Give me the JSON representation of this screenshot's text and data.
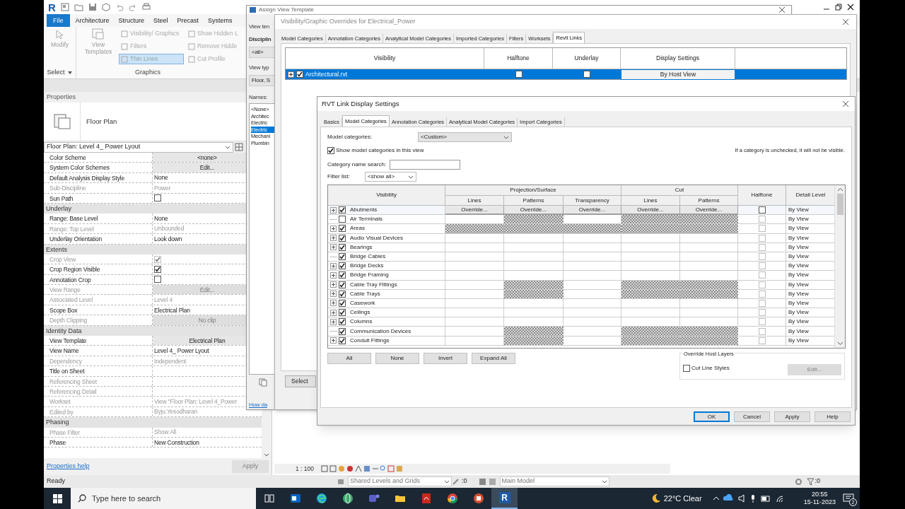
{
  "revit": {
    "quick_access_logo": "R",
    "ribbon_tabs": [
      {
        "label": "File",
        "selected": true
      },
      {
        "label": "Architecture",
        "selected": false
      },
      {
        "label": "Structure",
        "selected": false
      },
      {
        "label": "Steel",
        "selected": false
      },
      {
        "label": "Precast",
        "selected": false
      },
      {
        "label": "Systems",
        "selected": false
      }
    ],
    "ribbon": {
      "modify": "Modify",
      "select": "Select",
      "view_templates": "View Templates",
      "graphics_tools": [
        {
          "label": "Visibility/ Graphics",
          "selected": false
        },
        {
          "label": "Filters",
          "selected": false
        },
        {
          "label": "Thin Lines",
          "selected": true
        }
      ],
      "hidden_tools": [
        "Show Hidden L",
        "Remove Hidde",
        "Cut Profile"
      ],
      "panel_label": "Graphics"
    },
    "properties": {
      "title": "Properties",
      "type_name": "Floor Plan",
      "view_selector": "Floor Plan: Level 4_ Power Lyout",
      "groups": [
        {
          "rows": [
            {
              "name": "Color Scheme",
              "kind": "button",
              "value": "<none>",
              "disabled": false
            },
            {
              "name": "System Color Schemes",
              "kind": "button",
              "value": "Edit...",
              "disabled": false
            },
            {
              "name": "Default Analysis Display Style",
              "kind": "text",
              "value": "None",
              "disabled": false
            },
            {
              "name": "Sub-Discipline",
              "kind": "text",
              "value": "Power",
              "disabled": true
            },
            {
              "name": "Sun Path",
              "kind": "checkbox",
              "checked": false,
              "disabled": false
            }
          ]
        },
        {
          "title": "Underlay",
          "rows": [
            {
              "name": "Range: Base Level",
              "kind": "text",
              "value": "None",
              "disabled": false
            },
            {
              "name": "Range: Top Level",
              "kind": "text",
              "value": "Unbounded",
              "disabled": true
            },
            {
              "name": "Underlay Orientation",
              "kind": "text",
              "value": "Look down",
              "disabled": false
            }
          ]
        },
        {
          "title": "Extents",
          "rows": [
            {
              "name": "Crop View",
              "kind": "checkbox",
              "checked": true,
              "disabled": true
            },
            {
              "name": "Crop Region Visible",
              "kind": "checkbox",
              "checked": true,
              "disabled": false
            },
            {
              "name": "Annotation Crop",
              "kind": "checkbox",
              "checked": false,
              "disabled": false
            },
            {
              "name": "View Range",
              "kind": "button",
              "value": "Edit...",
              "disabled": true
            },
            {
              "name": "Associated Level",
              "kind": "text",
              "value": "Level 4",
              "disabled": true
            },
            {
              "name": "Scope Box",
              "kind": "text",
              "value": "Electrical Plan",
              "disabled": false
            },
            {
              "name": "Depth Clipping",
              "kind": "button",
              "value": "No clip",
              "disabled": true
            }
          ]
        },
        {
          "title": "Identity Data",
          "rows": [
            {
              "name": "View Template",
              "kind": "button",
              "value": "Electrical Plan",
              "disabled": false
            },
            {
              "name": "View Name",
              "kind": "text",
              "value": "Level 4_ Power Lyout",
              "disabled": false
            },
            {
              "name": "Dependency",
              "kind": "text",
              "value": "Independent",
              "disabled": true
            },
            {
              "name": "Title on Sheet",
              "kind": "text",
              "disabled": false
            },
            {
              "name": "Referencing Sheet",
              "kind": "text",
              "disabled": true
            },
            {
              "name": "Referencing Detail",
              "kind": "text",
              "disabled": true
            },
            {
              "name": "Workset",
              "kind": "text",
              "value": "View \"Floor Plan: Level 4_Power",
              "disabled": true
            },
            {
              "name": "Edited by",
              "kind": "text",
              "value": "Byju.Yesodharan",
              "disabled": true
            }
          ]
        },
        {
          "title": "Phasing",
          "rows": [
            {
              "name": "Phase Filter",
              "kind": "text",
              "value": "Show All",
              "disabled": true
            },
            {
              "name": "Phase",
              "kind": "text",
              "value": "New Construction",
              "disabled": false
            }
          ]
        }
      ],
      "help_link": "Properties help",
      "apply": {
        "label": "Apply",
        "disabled": true
      }
    },
    "view_bar": {
      "scale": "1 : 100"
    },
    "status_bar": {
      "text": "Ready",
      "workset": "Shared Levels and Grids",
      "editable_count": ":0",
      "design_option": "Main Model",
      "filter_count": ":0"
    }
  },
  "assign_dialog": {
    "title": "Assign View Template",
    "view_templates_label": "View ten",
    "discipline_label": "Disciplin",
    "discipline_value": "<all>",
    "view_type_label": "View typ",
    "view_type_value": "Floor, S",
    "names_label": "Names:",
    "names": [
      {
        "label": "<None>",
        "selected": false
      },
      {
        "label": "Architec",
        "selected": false
      },
      {
        "label": "Electric",
        "selected": false
      },
      {
        "label": "Electric",
        "selected": true
      },
      {
        "label": "Mechani",
        "selected": false
      },
      {
        "label": "Plumbin",
        "selected": false
      }
    ],
    "help_link": "How da"
  },
  "vg_dialog": {
    "title": "Visibility/Graphic Overrides for Electrical_Power",
    "tabs": [
      {
        "label": "Model Categories",
        "selected": false
      },
      {
        "label": "Annotation Categories",
        "selected": false
      },
      {
        "label": "Analytical Model Categories",
        "selected": false
      },
      {
        "label": "Imported Categories",
        "selected": false
      },
      {
        "label": "Filters",
        "selected": false
      },
      {
        "label": "Worksets",
        "selected": false
      },
      {
        "label": "Revit Links",
        "selected": true
      }
    ],
    "columns": [
      "Visibility",
      "Halftone",
      "Underlay",
      "Display Settings"
    ],
    "links": [
      {
        "name": "Architectural.rvt",
        "visible": true,
        "halftone": false,
        "underlay": false,
        "display": "By Host View",
        "selected": true
      }
    ],
    "bottom_button": "Select"
  },
  "rvt_dialog": {
    "title": "RVT Link Display Settings",
    "tabs": [
      {
        "label": "Basics",
        "selected": false
      },
      {
        "label": "Model Categories",
        "selected": true
      },
      {
        "label": "Annotation Categories",
        "selected": false
      },
      {
        "label": "Analytical Model Categories",
        "selected": false
      },
      {
        "label": "Import Categories",
        "selected": false
      }
    ],
    "model_categories_label": "Model categories:",
    "model_categories_value": "<Custom>",
    "show_categories": {
      "label": "Show model categories in this view",
      "checked": true
    },
    "note": "If a category is unchecked, it will not be visible.",
    "search_label": "Category name search:",
    "filter_label": "Filter list:",
    "filter_value": "<show all>",
    "columns": {
      "visibility": "Visibility",
      "projection": {
        "title": "Projection/Surface",
        "subcolumns": [
          "Lines",
          "Patterns",
          "Transparency"
        ]
      },
      "cut": {
        "title": "Cut",
        "subcolumns": [
          "Lines",
          "Patterns"
        ]
      },
      "halftone": "Halftone",
      "detail_level": "Detail Level"
    },
    "rows": [
      {
        "name": "Abutments",
        "visible": true,
        "expandable": true,
        "selected": true,
        "cells": [
          {
            "kind": "button",
            "label": "Override..."
          },
          {
            "kind": "button",
            "label": "Override..."
          },
          {
            "kind": "button",
            "label": "Override..."
          },
          {
            "kind": "button",
            "label": "Override..."
          },
          {
            "kind": "button",
            "label": "Override..."
          }
        ],
        "halftone": false,
        "detail_level": "By View"
      },
      {
        "name": "Air Terminals",
        "visible": false,
        "expandable": false,
        "selected": false,
        "cells": [
          {
            "kind": "blank"
          },
          {
            "kind": "hatched"
          },
          {
            "kind": "blank"
          },
          {
            "kind": "hatched"
          },
          {
            "kind": "hatched"
          }
        ],
        "halftone": false,
        "detail_level": "By View"
      },
      {
        "name": "Areas",
        "visible": true,
        "expandable": true,
        "selected": false,
        "cells": [
          {
            "kind": "hatched"
          },
          {
            "kind": "hatched"
          },
          {
            "kind": "hatched"
          },
          {
            "kind": "hatched"
          },
          {
            "kind": "hatched"
          }
        ],
        "halftone": false,
        "detail_level": "By View"
      },
      {
        "name": "Audio Visual Devices",
        "visible": true,
        "expandable": true,
        "selected": false,
        "cells": [
          {
            "kind": "blank"
          },
          {
            "kind": "blank"
          },
          {
            "kind": "blank"
          },
          {
            "kind": "blank"
          },
          {
            "kind": "blank"
          }
        ],
        "halftone": false,
        "detail_level": "By View"
      },
      {
        "name": "Bearings",
        "visible": true,
        "expandable": true,
        "selected": false,
        "cells": [
          {
            "kind": "blank"
          },
          {
            "kind": "blank"
          },
          {
            "kind": "blank"
          },
          {
            "kind": "blank"
          },
          {
            "kind": "blank"
          }
        ],
        "halftone": false,
        "detail_level": "By View"
      },
      {
        "name": "Bridge Cables",
        "visible": true,
        "expandable": false,
        "selected": false,
        "cells": [
          {
            "kind": "blank"
          },
          {
            "kind": "blank"
          },
          {
            "kind": "blank"
          },
          {
            "kind": "blank"
          },
          {
            "kind": "blank"
          }
        ],
        "halftone": false,
        "detail_level": "By View"
      },
      {
        "name": "Bridge Decks",
        "visible": true,
        "expandable": true,
        "selected": false,
        "cells": [
          {
            "kind": "blank"
          },
          {
            "kind": "blank"
          },
          {
            "kind": "blank"
          },
          {
            "kind": "blank"
          },
          {
            "kind": "blank"
          }
        ],
        "halftone": false,
        "detail_level": "By View"
      },
      {
        "name": "Bridge Framing",
        "visible": true,
        "expandable": true,
        "selected": false,
        "cells": [
          {
            "kind": "blank"
          },
          {
            "kind": "blank"
          },
          {
            "kind": "blank"
          },
          {
            "kind": "blank"
          },
          {
            "kind": "blank"
          }
        ],
        "halftone": false,
        "detail_level": "By View"
      },
      {
        "name": "Cable Tray Fittings",
        "visible": true,
        "expandable": true,
        "selected": false,
        "cells": [
          {
            "kind": "blank"
          },
          {
            "kind": "hatched"
          },
          {
            "kind": "blank"
          },
          {
            "kind": "hatched"
          },
          {
            "kind": "hatched"
          }
        ],
        "halftone": false,
        "detail_level": "By View"
      },
      {
        "name": "Cable Trays",
        "visible": true,
        "expandable": true,
        "selected": false,
        "cells": [
          {
            "kind": "blank"
          },
          {
            "kind": "hatched"
          },
          {
            "kind": "blank"
          },
          {
            "kind": "hatched"
          },
          {
            "kind": "hatched"
          }
        ],
        "halftone": false,
        "detail_level": "By View"
      },
      {
        "name": "Casework",
        "visible": true,
        "expandable": true,
        "selected": false,
        "cells": [
          {
            "kind": "blank"
          },
          {
            "kind": "blank"
          },
          {
            "kind": "blank"
          },
          {
            "kind": "blank"
          },
          {
            "kind": "blank"
          }
        ],
        "halftone": false,
        "detail_level": "By View"
      },
      {
        "name": "Ceilings",
        "visible": true,
        "expandable": true,
        "selected": false,
        "cells": [
          {
            "kind": "blank"
          },
          {
            "kind": "blank"
          },
          {
            "kind": "blank"
          },
          {
            "kind": "blank"
          },
          {
            "kind": "blank"
          }
        ],
        "halftone": false,
        "detail_level": "By View"
      },
      {
        "name": "Columns",
        "visible": true,
        "expandable": true,
        "selected": false,
        "cells": [
          {
            "kind": "blank"
          },
          {
            "kind": "blank"
          },
          {
            "kind": "blank"
          },
          {
            "kind": "blank"
          },
          {
            "kind": "blank"
          }
        ],
        "halftone": false,
        "detail_level": "By View"
      },
      {
        "name": "Communication Devices",
        "visible": true,
        "expandable": false,
        "selected": false,
        "cells": [
          {
            "kind": "blank"
          },
          {
            "kind": "hatched"
          },
          {
            "kind": "blank"
          },
          {
            "kind": "hatched"
          },
          {
            "kind": "hatched"
          }
        ],
        "halftone": false,
        "detail_level": "By View"
      },
      {
        "name": "Conduit Fittings",
        "visible": true,
        "expandable": true,
        "selected": false,
        "cells": [
          {
            "kind": "blank"
          },
          {
            "kind": "hatched"
          },
          {
            "kind": "blank"
          },
          {
            "kind": "hatched"
          },
          {
            "kind": "hatched"
          }
        ],
        "halftone": false,
        "detail_level": "By View"
      }
    ],
    "list_buttons": [
      "All",
      "None",
      "Invert",
      "Expand All"
    ],
    "override_host": {
      "title": "Override Host Layers",
      "cut_line_styles": {
        "label": "Cut Line Styles",
        "checked": false
      },
      "edit": {
        "label": "Edit...",
        "disabled": true
      }
    },
    "footer_buttons": [
      {
        "label": "OK",
        "default": true
      },
      {
        "label": "Cancel",
        "default": false
      },
      {
        "label": "Apply",
        "default": false
      },
      {
        "label": "Help",
        "default": false
      }
    ]
  },
  "taskbar": {
    "search_placeholder": "Type here to search",
    "apps": [
      {
        "kind": "task-view",
        "active": false
      },
      {
        "kind": "mail",
        "active": false
      },
      {
        "kind": "edge",
        "active": false
      },
      {
        "kind": "globe",
        "active": false
      },
      {
        "kind": "chat",
        "active": false
      },
      {
        "kind": "folder",
        "active": false
      },
      {
        "kind": "pdf",
        "active": false
      },
      {
        "kind": "chrome",
        "active": false
      },
      {
        "kind": "slides",
        "active": false
      },
      {
        "kind": "revit",
        "label": "R",
        "active": true
      }
    ],
    "weather": "22°C Clear",
    "time": "20:55",
    "date": "15-11-2023",
    "notifications": "2"
  }
}
